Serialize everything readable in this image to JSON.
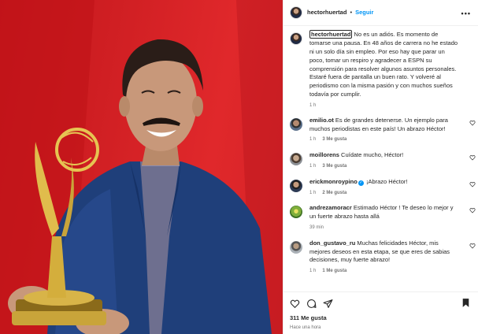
{
  "header": {
    "username": "hectorhuertad",
    "separator": "•",
    "follow_label": "Seguir",
    "more_label": "•••"
  },
  "caption": {
    "username": "hectorhuertad",
    "text": " No es un adiós. Es momento de tomarse una pausa. En 48 años de carrera no he estado ni un solo día sin empleo. Por eso hay que parar un poco, tomar un respiro y agradecer a ESPN su comprensión para resolver algunos asuntos personales. Estaré fuera de pantalla un buen rato. Y volveré al periodismo con la misma pasión y con muchos sueños todavía por cumplir.",
    "time": "1 h"
  },
  "comments": [
    {
      "username": "emilio.ot",
      "text": " Es de grandes detenerse. Un ejemplo para muchos periodistas en este país! Un abrazo Héctor!",
      "time": "1 h",
      "likes": "3 Me gusta",
      "reply": ""
    },
    {
      "username": "moillorens",
      "text": " Cuídate mucho, Héctor!",
      "time": "1 h",
      "likes": "3 Me gusta",
      "reply": ""
    },
    {
      "username": "erickmonroypino",
      "text": " ¡Abrazo Héctor!",
      "time": "1 h",
      "likes": "2 Me gusta",
      "reply": ""
    },
    {
      "username": "andrezamoracr",
      "text": " Estimado Héctor ! Te deseo lo mejor y un fuerte abrazo hasta allá",
      "time": "39 min",
      "likes": "",
      "reply": ""
    },
    {
      "username": "don_gustavo_ru",
      "text": " Muchas felicidades Héctor, mis mejores deseos en esta etapa, se que eres de sabias decisiones, muy fuerte abrazo!",
      "time": "1 h",
      "likes": "1 Me gusta",
      "reply": ""
    }
  ],
  "verified_mark": "✓",
  "footer": {
    "likes": "311 Me gusta",
    "time": "Hace una hora"
  },
  "icons": [
    "heart-icon",
    "comment-icon",
    "share-icon",
    "bookmark-icon"
  ],
  "colors": {
    "accent": "#0095f6",
    "text": "#262626",
    "muted": "#737373",
    "background_red": "#d01f23"
  }
}
